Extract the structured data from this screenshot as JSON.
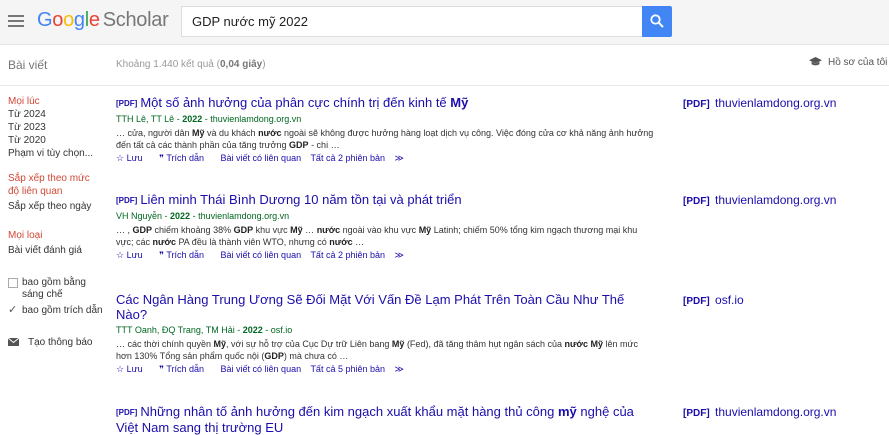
{
  "header": {
    "logo_google": [
      "G",
      "o",
      "o",
      "g",
      "l",
      "e"
    ],
    "logo_scholar": "Scholar",
    "search_value": "GDP nước mỹ 2022"
  },
  "subbar": {
    "section": "Bài viết",
    "count_prefix": "Khoảng 1.440 kết quả (",
    "count_time": "0,04 giây",
    "count_suffix": ")",
    "profile": "Hồ sơ của tôi"
  },
  "sidebar": {
    "time_header": "Mọi lúc",
    "time_items": [
      "Từ 2024",
      "Từ 2023",
      "Từ 2020",
      "Phạm vi tùy chọn..."
    ],
    "sort_relevance": "Sắp xếp theo mức độ liên quan",
    "sort_date": "Sắp xếp theo ngày",
    "type_header": "Mọi loại",
    "type_review": "Bài viết đánh giá",
    "include_patents": "bao gồm bằng sáng chế",
    "include_citations": "bao gồm trích dẫn",
    "create_alert": "Tạo thông báo"
  },
  "results": [
    {
      "pdf_tag": "[PDF]",
      "title_html": "Một số ảnh hưởng của phân cực chính trị đến kinh tế <b>Mỹ</b>",
      "authors": "TTH Lê, TT Lê",
      "year": "2022",
      "source": "thuvienlamdong.org.vn",
      "snippet_html": "… cửa, người dân <b>Mỹ</b> và du khách <b>nước</b> ngoài sẽ không được hưởng hàng loạt dịch vụ công. Việc đóng cửa cơ khả năng ảnh hưởng đến tất cả các thành phần của tăng trưởng <b>GDP</b> - chi …",
      "save": "Lưu",
      "cite": "Trích dẫn",
      "related": "Bài viết có liên quan",
      "versions": "Tất cả 2 phiên bản",
      "side_tag": "[PDF]",
      "side_domain": "thuvienlamdong.org.vn"
    },
    {
      "pdf_tag": "[PDF]",
      "title_html": "Liên minh Thái Bình Dương 10 năm tồn tại và phát triển",
      "authors": "VH Nguyễn",
      "year": "2022",
      "source": "thuvienlamdong.org.vn",
      "snippet_html": "… , <b>GDP</b> chiếm khoảng 38% <b>GDP</b> khu vực <b>Mỹ</b> … <b>nước</b> ngoài vào khu vực <b>Mỹ</b> Latinh; chiếm 50% tổng kim ngạch thương mại khu vực; các <b>nước</b> PA đều là thành viên WTO, nhưng có <b>nước</b> …",
      "save": "Lưu",
      "cite": "Trích dẫn",
      "related": "Bài viết có liên quan",
      "versions": "Tất cả 2 phiên bản",
      "side_tag": "[PDF]",
      "side_domain": "thuvienlamdong.org.vn"
    },
    {
      "pdf_tag": "",
      "title_html": "Các Ngân Hàng Trung Ương Sẽ Đối Mặt Với Vấn Đề Lạm Phát Trên Toàn Cầu Như Thế Nào?",
      "authors": "TTT Oanh, ĐQ Trang, TM Hải",
      "year": "2022",
      "source": "osf.io",
      "snippet_html": "… các thời chính quyền <b>Mỹ</b>, với sự hỗ trợ của Cục Dự trữ Liên bang <b>Mỹ</b> (Fed), đã tăng thâm hụt ngân sách của <b>nước Mỹ</b> lên mức hơn 130% Tổng sản phẩm quốc nội (<b>GDP</b>) mà chưa có …",
      "save": "Lưu",
      "cite": "Trích dẫn",
      "related": "Bài viết có liên quan",
      "versions": "Tất cả 5 phiên bản",
      "side_tag": "[PDF]",
      "side_domain": "osf.io"
    },
    {
      "pdf_tag": "[PDF]",
      "title_html": "Những nhân tố ảnh hưởng đến kim ngạch xuất khẩu mặt hàng thủ công <b>mỹ</b> nghệ của Việt Nam sang thị trường EU",
      "authors": "",
      "year": "",
      "source": "",
      "snippet_html": "",
      "save": "",
      "cite": "",
      "related": "",
      "versions": "",
      "side_tag": "[PDF]",
      "side_domain": "thuvienlamdong.org.vn"
    }
  ],
  "colors": {
    "link": "#1a0dab",
    "author_green": "#006621",
    "accent_red": "#d14836",
    "search_blue": "#4285f4"
  }
}
